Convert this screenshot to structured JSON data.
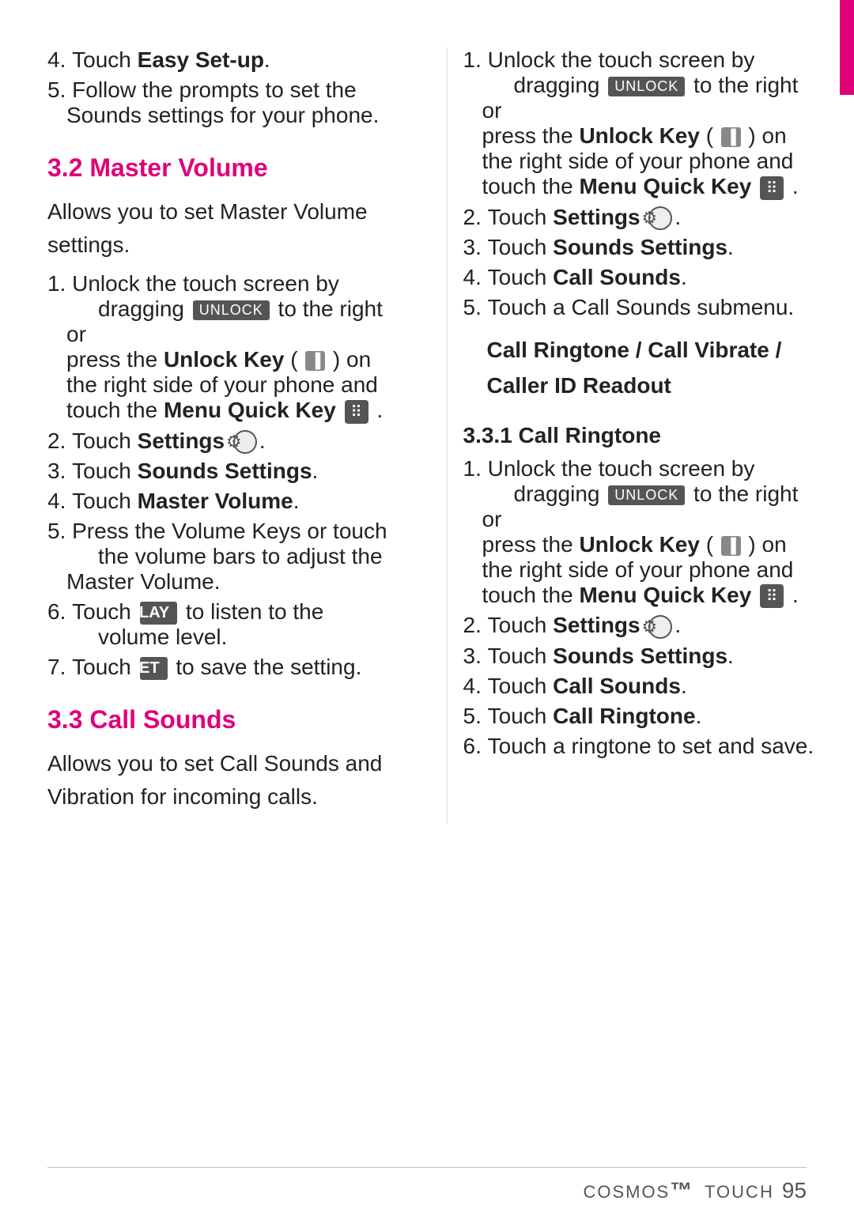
{
  "sidebar": {
    "color": "#e0007a"
  },
  "left_column": {
    "items": [
      {
        "num": "4",
        "text": "Touch ",
        "bold": "Easy Set-up",
        "after": "."
      },
      {
        "num": "5",
        "text": "Follow the prompts to set the Sounds settings for your phone."
      }
    ],
    "section_3_2": {
      "heading": "3.2 Master Volume",
      "description": "Allows you to set Master Volume settings.",
      "steps": [
        {
          "num": "1",
          "text": "Unlock the touch screen by dragging",
          "unlock_badge": "UNLOCK",
          "text2": "to the right or press the",
          "bold": "Unlock Key",
          "key_icon": "▐",
          "text3": ") on the right side of your phone and touch the",
          "bold2": "Menu Quick Key",
          "menu_icon": true
        },
        {
          "num": "2",
          "text": "Touch ",
          "bold": "Settings",
          "settings_icon": true
        },
        {
          "num": "3",
          "text": "Touch ",
          "bold": "Sounds Settings",
          "after": "."
        },
        {
          "num": "4",
          "text": "Touch ",
          "bold": "Master Volume",
          "after": "."
        },
        {
          "num": "5",
          "text": "Press the Volume Keys or touch the volume bars to adjust the Master Volume."
        },
        {
          "num": "6",
          "text": "Touch ",
          "play_badge": "PLAY",
          "text2": "to listen to the volume level."
        },
        {
          "num": "7",
          "text": "Touch ",
          "set_badge": "SET",
          "text2": "to save the setting."
        }
      ]
    },
    "section_3_3": {
      "heading": "3.3 Call Sounds",
      "description": "Allows you to set Call Sounds and Vibration for incoming calls."
    }
  },
  "right_column": {
    "step1_intro": {
      "num": "1",
      "text": "Unlock the touch screen by dragging",
      "unlock_badge": "UNLOCK",
      "text2": "to the right or press the",
      "bold": "Unlock Key",
      "key_icon": "▐",
      "text3": ") on the right side of your phone and touch the",
      "bold2": "Menu Quick Key",
      "menu_icon": true
    },
    "steps_2_to_5": [
      {
        "num": "2",
        "text": "Touch ",
        "bold": "Settings",
        "settings_icon": true
      },
      {
        "num": "3",
        "text": "Touch ",
        "bold": "Sounds Settings",
        "after": "."
      },
      {
        "num": "4",
        "text": "Touch ",
        "bold": "Call Sounds",
        "after": "."
      },
      {
        "num": "5",
        "text": "Touch a Call Sounds submenu."
      }
    ],
    "submenu": {
      "line1": "Call Ringtone / Call Vibrate /",
      "line2": "Caller ID Readout"
    },
    "section_3_3_1": {
      "heading": "3.3.1  Call Ringtone",
      "steps": [
        {
          "num": "1",
          "text": "Unlock the touch screen by dragging",
          "unlock_badge": "UNLOCK",
          "text2": "to the right or press the",
          "bold": "Unlock Key",
          "key_icon": "▐",
          "text3": ") on the right side of your phone and touch the",
          "bold2": "Menu Quick Key",
          "menu_icon": true
        },
        {
          "num": "2",
          "text": "Touch ",
          "bold": "Settings",
          "settings_icon": true
        },
        {
          "num": "3",
          "text": "Touch ",
          "bold": "Sounds Settings",
          "after": "."
        },
        {
          "num": "4",
          "text": "Touch ",
          "bold": "Call Sounds",
          "after": "."
        },
        {
          "num": "5",
          "text": "Touch ",
          "bold": "Call Ringtone",
          "after": "."
        },
        {
          "num": "6",
          "text": "Touch a ringtone to set and save."
        }
      ]
    }
  },
  "footer": {
    "brand": "cosmos",
    "touch": "TOUCH",
    "page": "95"
  }
}
